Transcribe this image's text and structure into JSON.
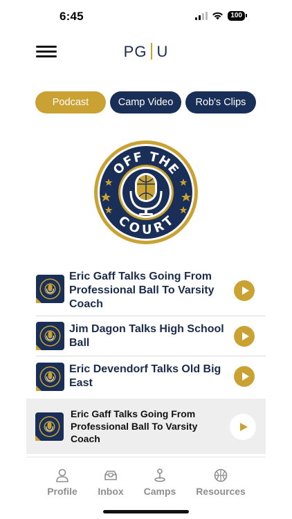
{
  "status_bar": {
    "time": "6:45",
    "battery": "100"
  },
  "header": {
    "logo_left": "PG",
    "logo_right": "U"
  },
  "tabs": [
    {
      "label": "Podcast",
      "active": true
    },
    {
      "label": "Camp Video",
      "active": false
    },
    {
      "label": "Rob's Clips",
      "active": false
    }
  ],
  "podcast": {
    "top_text": "OFF THE",
    "bottom_text": "COURT"
  },
  "episodes": [
    {
      "title": "Eric Gaff Talks Going From Professional Ball To Varsity Coach"
    },
    {
      "title": "Jim Dagon Talks High School Ball"
    },
    {
      "title": "Eric Devendorf Talks Old Big East"
    }
  ],
  "now_playing": {
    "title": "Eric Gaff Talks Going From Professional Ball To Varsity Coach"
  },
  "bottom_nav": [
    {
      "label": "Profile",
      "icon": "person-icon"
    },
    {
      "label": "Inbox",
      "icon": "inbox-icon"
    },
    {
      "label": "Camps",
      "icon": "map-pin-icon"
    },
    {
      "label": "Resources",
      "icon": "basketball-icon"
    }
  ],
  "colors": {
    "gold": "#c9a233",
    "navy": "#1a2f57",
    "gray": "#8e8e8e"
  }
}
